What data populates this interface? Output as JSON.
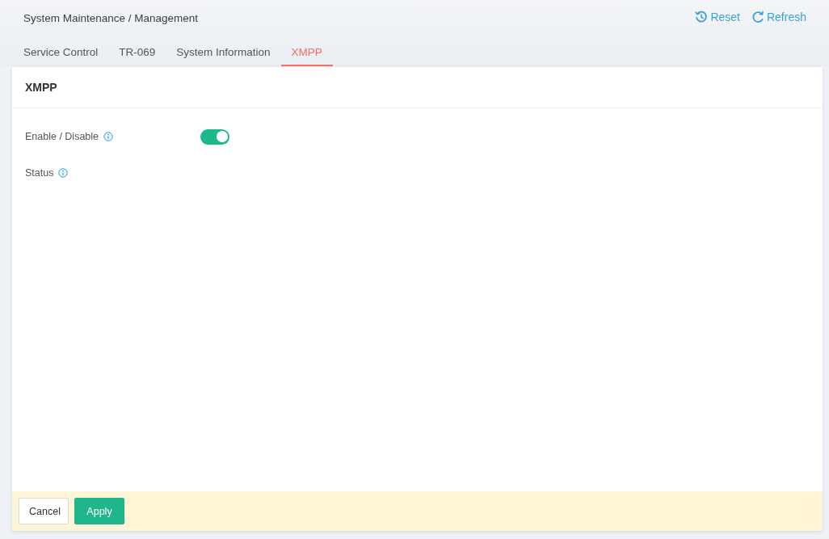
{
  "header": {
    "breadcrumb": "System Maintenance / Management",
    "actions": [
      {
        "kind": "reset",
        "label": "Reset"
      },
      {
        "kind": "refresh",
        "label": "Refresh"
      }
    ]
  },
  "tabs": [
    {
      "label": "Service Control",
      "selected": false
    },
    {
      "label": "TR-069",
      "selected": false
    },
    {
      "label": "System Information",
      "selected": false
    },
    {
      "label": "XMPP",
      "selected": true
    }
  ],
  "panel": {
    "title": "XMPP",
    "fields": [
      {
        "kind": "toggle",
        "label": "Enable / Disable",
        "on": true
      },
      {
        "kind": "status",
        "label": "Status"
      }
    ]
  },
  "footer": {
    "buttons": [
      {
        "kind": "secondary",
        "label": "Cancel"
      },
      {
        "kind": "primary",
        "label": "Apply"
      }
    ]
  }
}
